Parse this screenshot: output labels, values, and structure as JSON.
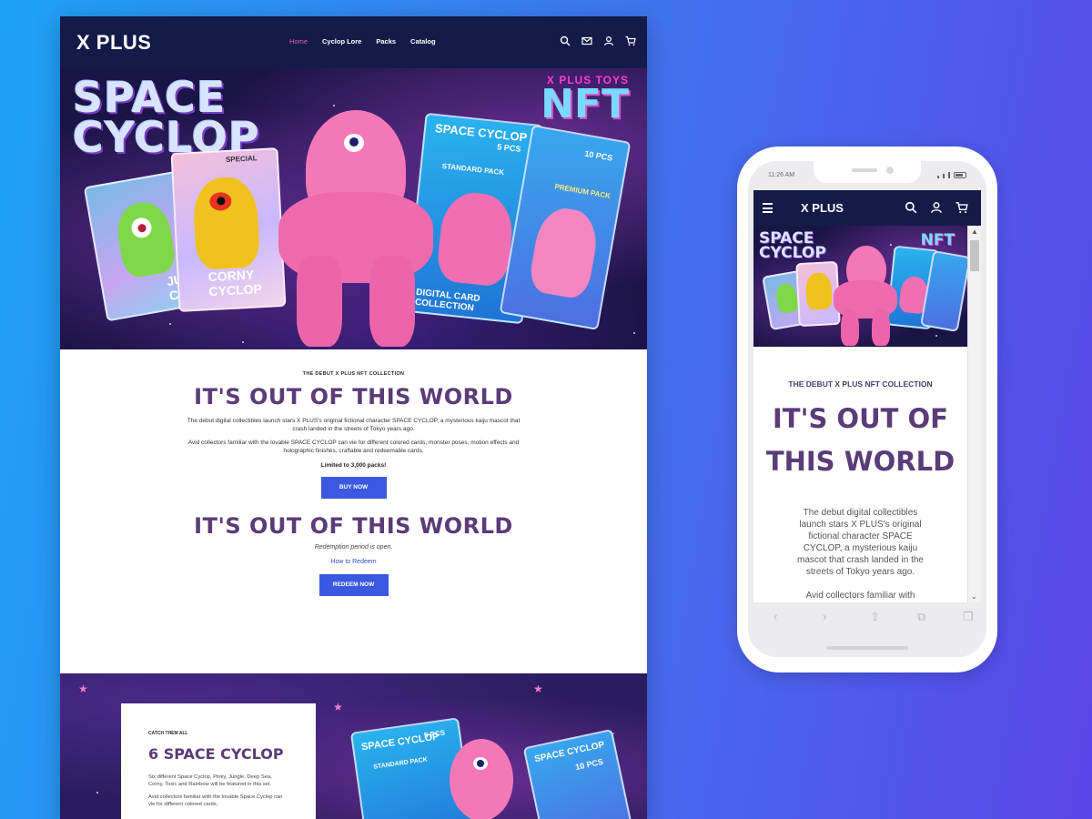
{
  "desktop": {
    "nav": {
      "logo": "X PLUS",
      "links": [
        "Home",
        "Cyclop Lore",
        "Packs",
        "Catalog"
      ],
      "active_link": "Home"
    },
    "hero": {
      "title_line1": "SPACE",
      "title_line2": "CYCLOP",
      "nft_small": "X PLUS TOYS",
      "nft_big": "NFT",
      "card_labels": [
        "JUNGLE CYCLOP",
        "CORNY CYCLOP",
        "SPECIAL",
        "SPACE CYCLOP",
        "STANDARD PACK",
        "5 PCS",
        "10 PCS",
        "PREMIUM PACK",
        "DIGITAL CARD COLLECTION"
      ]
    },
    "intro": {
      "eyebrow": "THE DEBUT X PLUS NFT COLLECTION",
      "heading": "IT'S OUT OF THIS WORLD",
      "para1": "The debut digital collectibles launch stars X PLUS's original fictional character SPACE CYCLOP, a mysterious kaiju mascot that crash landed in the streets of Tokyo years ago.",
      "para2": "Avid collectors familiar with the lovable SPACE CYCLOP can vie for different colored cards, monster poses, motion effects and holographic finishes, craftable and redeemable cards.",
      "limited": "Limited to 3,000 packs!",
      "buy_button": "BUY NOW"
    },
    "redeem": {
      "heading": "IT'S OUT OF THIS WORLD",
      "period": "Redemption period is open.",
      "how_link": "How to Redeem",
      "redeem_button": "REDEEM NOW"
    },
    "catch": {
      "eyebrow": "CATCH THEM ALL",
      "title": "6 SPACE CYCLOP",
      "text1": "Six different Space Cyclop, Pinky, Jungle, Deep Sea, Corny, Toxic and Rainbow will be featured in this set.",
      "text2": "Avid collectors familiar with the lovable Space Cyclop can vie for different colored cards,"
    }
  },
  "phone": {
    "status_time": "11:26 AM",
    "nav_logo": "X PLUS",
    "hero": {
      "title_line1": "SPACE",
      "title_line2": "CYCLOP",
      "nft_big": "NFT"
    },
    "eyebrow": "THE DEBUT X PLUS NFT COLLECTION",
    "heading": "IT'S OUT OF THIS WORLD",
    "para1": "The debut digital collectibles launch stars X PLUS's original fictional character SPACE CYCLOP, a mysterious kaiju mascot that crash landed in the streets of Tokyo years ago.",
    "para2": "Avid collectors familiar with",
    "toolbar": {
      "back": "‹",
      "forward": "›",
      "share": "⇪",
      "bookmarks": "⧉",
      "tabs": "❐"
    }
  },
  "colors": {
    "nav_bg": "#151b48",
    "accent_pink": "#f25aa3",
    "heading_purple": "#5b3b78",
    "button_blue": "#3b59e0"
  }
}
